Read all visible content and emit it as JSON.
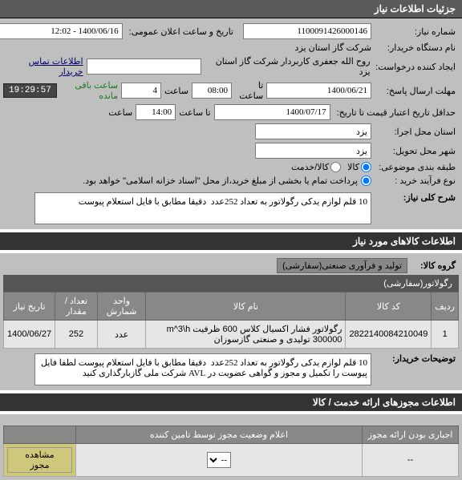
{
  "header": {
    "title": "جزئیات اطلاعات نیاز"
  },
  "form": {
    "req_no_label": "شماره نیاز:",
    "req_no": "1100091426000146",
    "announce_dt_label": "تاریخ و ساعت اعلان عمومی:",
    "announce_dt": "1400/06/16 - 12:02",
    "buyer_label": "نام دستگاه خریدار:",
    "buyer": "شرکت گاز استان یزد",
    "requester_label": "ایجاد کننده درخواست:",
    "requester": "روح الله جعفری کاربردار شرکت گاز استان یزد",
    "contact_link": "اطلاعات تماس خریدار",
    "deadline_label": "مهلت ارسال پاسخ:",
    "deadline_date": "1400/06/21",
    "deadline_time_label": "تا ساعت",
    "deadline_time": "08:00",
    "days_label": "ساعت",
    "days_value": "4",
    "remaining_label": "ساعت باقی مانده",
    "countdown": "19:29:57",
    "min_valid_label": "حداقل تاریخ اعتبار قیمت تا تاریخ:",
    "min_valid_date": "1400/07/17",
    "min_valid_time_label": "تا ساعت",
    "min_valid_time": "14:00",
    "time_suffix": "ساعت",
    "exec_province_label": "استان محل اجرا:",
    "exec_province": "یزد",
    "delivery_city_label": "شهر محل تحویل:",
    "delivery_city": "یزد",
    "category_label": "طبقه بندی موضوعی:",
    "category_good": "کالا",
    "category_service": "کالا/خدمت",
    "process_label": "نوع فرآیند خرید :",
    "process_note": "پرداخت تمام یا بخشی از مبلغ خرید،از محل \"اسناد خزانه اسلامی\" خواهد بود."
  },
  "summary": {
    "label": "شرح کلی نیاز:",
    "text": "10 قلم لوازم یدکی رگولاتور به تعداد 252عدد  دقیقا مطابق با فایل استعلام پیوست"
  },
  "goods_header": "اطلاعات کالاهای مورد نیاز",
  "goods_group_label": "گروه کالا:",
  "goods_group": "تولید و فرآوری صنعتی(سفارشی)",
  "goods_sub": "رگولاتور(سفارشی)",
  "table": {
    "headers": [
      "ردیف",
      "کد کالا",
      "نام کالا",
      "واحد شمارش",
      "تعداد / مقدار",
      "تاریخ نیاز"
    ],
    "rows": [
      {
        "idx": "1",
        "code": "2822140084210049",
        "name": "رگولاتور فشار اکسیال کلاس 600 ظرفیت m^3\\h 300000 تولیدی و صنعتی گازسوزان",
        "unit": "عدد",
        "qty": "252",
        "date": "1400/06/27"
      }
    ]
  },
  "buyer_notes_label": "توضیحات خریدار:",
  "buyer_notes": "10 قلم لوازم یدکی رگولاتور به تعداد 252عدد  دقیقا مطابق با فایل استعلام پیوست لطفا فایل پیوست را تکمیل و مجوز و گواهی عضویت در AVL شرکت ملی گازبارگذاری کنید",
  "permits_header": "اطلاعات مجوزهای ارائه خدمت / کالا",
  "permits": {
    "mandatory_label": "اجباری بودن ارائه مجوز",
    "status_label": "اعلام وضعیت مجوز توسط تامین کننده",
    "view_btn": "مشاهده مجوز",
    "dash": "--",
    "dash2": "--"
  }
}
